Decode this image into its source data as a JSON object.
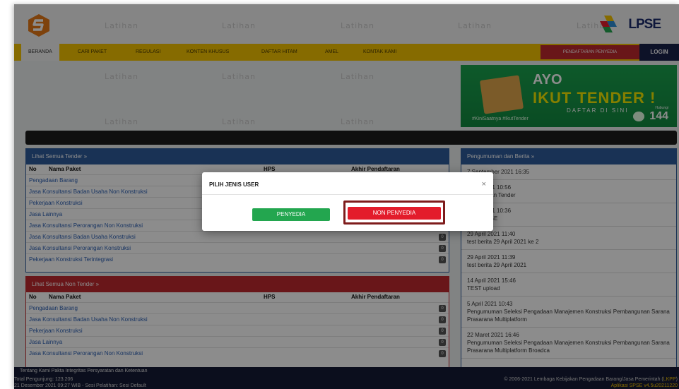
{
  "header": {
    "watermark": "Latihan",
    "brand": "LPSE"
  },
  "nav": {
    "items": [
      "BERANDA",
      "CARI PAKET",
      "REGULASI",
      "KONTEN KHUSUS",
      "DAFTAR HITAM",
      "AMEL",
      "KONTAK KAMI"
    ],
    "register": "PENDAFTARAN PENYEDIA",
    "login": "LOGIN"
  },
  "banner": {
    "line1": "AYO",
    "line2": "IKUT TENDER !",
    "line3": "DAFTAR DI SINI",
    "hashtag": "#KiniSaatnya #IkutTender",
    "hubungi": "Hubungi",
    "number": "144"
  },
  "tender": {
    "title": "Lihat Semua Tender »",
    "col_no": "No",
    "col_nama": "Nama Paket",
    "col_hps": "HPS",
    "col_akhir": "Akhir Pendaftaran",
    "rows": [
      "Pengadaan Barang",
      "Jasa Konsultansi Badan Usaha Non Konstruksi",
      "Pekerjaan Konstruksi",
      "Jasa Lainnya",
      "Jasa Konsultansi Perorangan Non Konstruksi",
      "Jasa Konsultansi Badan Usaha Konstruksi",
      "Jasa Konsultansi Perorangan Konstruksi",
      "Pekerjaan Konstruksi Terintegrasi"
    ],
    "count": "0"
  },
  "nontender": {
    "title": "Lihat Semua Non Tender »",
    "col_no": "No",
    "col_nama": "Nama Paket",
    "col_hps": "HPS",
    "col_akhir": "Akhir Pendaftaran",
    "rows": [
      "Pengadaan Barang",
      "Jasa Konsultansi Badan Usaha Non Konstruksi",
      "Pekerjaan Konstruksi",
      "Jasa Lainnya",
      "Jasa Konsultansi Perorangan Non Konstruksi"
    ],
    "count": "0"
  },
  "news": {
    "title": "Pengumuman dan Berita »",
    "items": [
      {
        "date": "7 September 2021 16:35",
        "text": ""
      },
      {
        "date": "2021 10:56",
        "text": "uman Tender"
      },
      {
        "date": "2021 10:36",
        "text": "SPSE"
      },
      {
        "date": "29 April 2021 11:40",
        "text": "test berita 29 April 2021 ke 2"
      },
      {
        "date": "29 April 2021 11:39",
        "text": "test berita 29 April 2021"
      },
      {
        "date": "14 April 2021 15:46",
        "text": "TEST upload"
      },
      {
        "date": "5 April 2021 10:43",
        "text": "Pengumuman Seleksi Pengadaan Manajemen Konstruksi Pembangunan Sarana Prasarana Multiplatform"
      },
      {
        "date": "22 Maret 2021 16:46",
        "text": "Pengumuman Seleksi Pengadaan Manajemen Konstruksi Pembangunan Sarana Prasarana Multiplatform Broadca"
      }
    ]
  },
  "footer": {
    "links": "Tentang Kami   Pakta Integritas   Persyaratan dan Ketentuan",
    "visitors": "Total Pengunjung: 123.206",
    "session": "21 Desember 2021 09:27 WIB - Sesi Pelatihan: Sesi Default",
    "copyright": "© 2006-2021 Lembaga Kebijakan Pengadaan Barang/Jasa Pemerintah (",
    "lkpp": "LKPP",
    "copyright_end": ")",
    "version": "Aplikasi SPSE v4.5u20211220"
  },
  "modal": {
    "title": "PILIH JENIS USER",
    "close": "×",
    "btn_penyedia": "PENYEDIA",
    "btn_non_penyedia": "NON PENYEDIA"
  },
  "colors": {
    "nav": "#f5c400",
    "login": "#18224a",
    "register": "#c0282e",
    "panel_blue": "#2f5c9b",
    "panel_red": "#c0282e",
    "penyedia": "#23a64f",
    "non_penyedia": "#e31c2b"
  }
}
